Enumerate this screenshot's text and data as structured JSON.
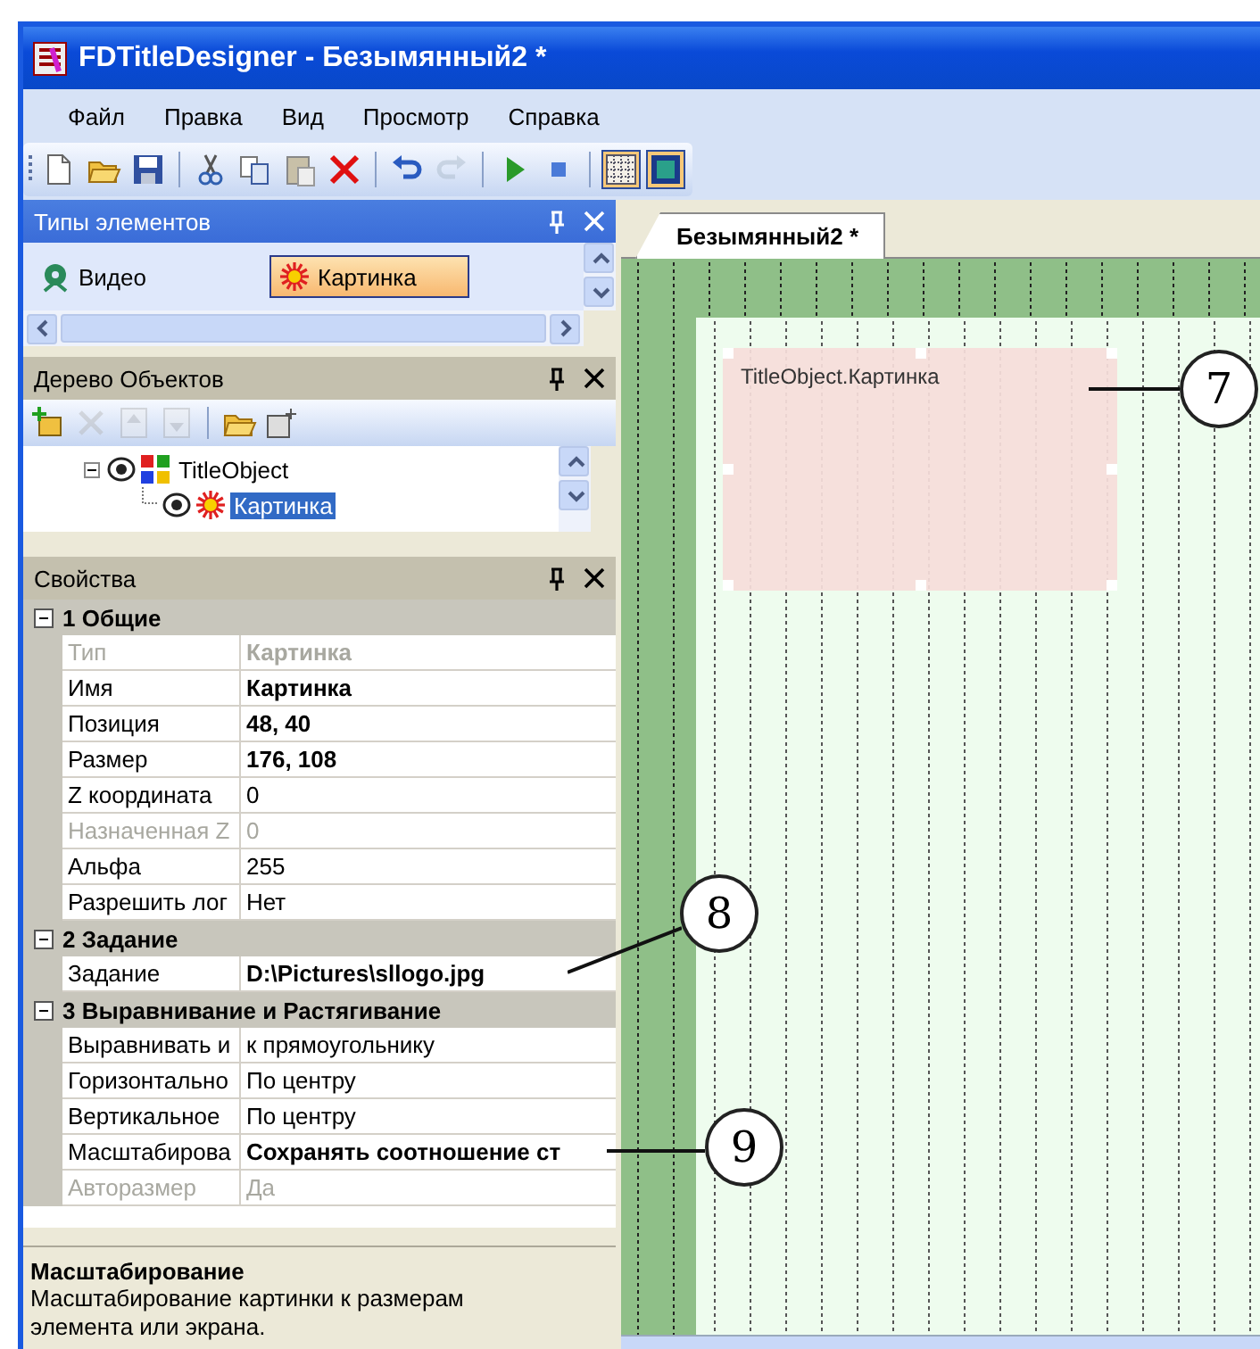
{
  "window": {
    "title": "FDTitleDesigner - Безымянный2 *"
  },
  "menu": [
    {
      "label": "Файл"
    },
    {
      "label": "Правка"
    },
    {
      "label": "Вид"
    },
    {
      "label": "Просмотр"
    },
    {
      "label": "Справка"
    }
  ],
  "toolbar": [
    {
      "kind": "new",
      "pressed": false,
      "disabled": false
    },
    {
      "kind": "open",
      "pressed": false,
      "disabled": false
    },
    {
      "kind": "save",
      "pressed": false,
      "disabled": false
    },
    {
      "kind": "separator"
    },
    {
      "kind": "cut",
      "pressed": false,
      "disabled": false
    },
    {
      "kind": "copy",
      "pressed": false,
      "disabled": false
    },
    {
      "kind": "paste",
      "pressed": false,
      "disabled": false
    },
    {
      "kind": "delete",
      "pressed": false,
      "disabled": false
    },
    {
      "kind": "separator"
    },
    {
      "kind": "undo",
      "pressed": false,
      "disabled": false
    },
    {
      "kind": "redo",
      "pressed": false,
      "disabled": true
    },
    {
      "kind": "separator"
    },
    {
      "kind": "play",
      "pressed": false,
      "disabled": false
    },
    {
      "kind": "stop",
      "pressed": false,
      "disabled": false
    },
    {
      "kind": "separator"
    },
    {
      "kind": "grid",
      "pressed": true,
      "disabled": false
    },
    {
      "kind": "frame",
      "pressed": true,
      "disabled": false
    }
  ],
  "element_types": {
    "title": "Типы элементов",
    "items": [
      {
        "label": "Видео",
        "kind": "video",
        "selected": false
      },
      {
        "label": "Картинка",
        "kind": "picture",
        "selected": true
      }
    ]
  },
  "object_tree": {
    "title": "Дерево Объектов",
    "tools": [
      {
        "kind": "add",
        "disabled": false
      },
      {
        "kind": "delete",
        "disabled": true
      },
      {
        "kind": "up",
        "disabled": true
      },
      {
        "kind": "down",
        "disabled": true
      },
      {
        "kind": "separator"
      },
      {
        "kind": "open",
        "disabled": false
      },
      {
        "kind": "export",
        "disabled": false
      }
    ],
    "nodes": [
      {
        "label": "TitleObject",
        "kind": "object",
        "expanded": true,
        "selected": false,
        "children": [
          {
            "label": "Картинка",
            "kind": "picture",
            "selected": true
          }
        ]
      }
    ]
  },
  "properties": {
    "title": "Свойства",
    "categories": [
      {
        "label": "1 Общие",
        "expanded": true,
        "rows": [
          {
            "name": "Тип",
            "value": "Картинка",
            "disabled": true,
            "modified": true
          },
          {
            "name": "Имя",
            "value": "Картинка",
            "disabled": false,
            "modified": true
          },
          {
            "name": "Позиция",
            "value": "48, 40",
            "disabled": false,
            "modified": true
          },
          {
            "name": "Размер",
            "value": "176, 108",
            "disabled": false,
            "modified": true
          },
          {
            "name": "Z координата",
            "value": "0",
            "disabled": false,
            "modified": false
          },
          {
            "name": "Назначенная Z",
            "value": "0",
            "disabled": true,
            "modified": false
          },
          {
            "name": "Альфа",
            "value": "255",
            "disabled": false,
            "modified": false
          },
          {
            "name": "Разрешить лог",
            "value": "Нет",
            "disabled": false,
            "modified": false
          }
        ]
      },
      {
        "label": "2 Задание",
        "expanded": true,
        "rows": [
          {
            "name": "Задание",
            "value": "D:\\Pictures\\sllogo.jpg",
            "disabled": false,
            "modified": true
          }
        ]
      },
      {
        "label": "3 Выравнивание и Растягивание",
        "expanded": true,
        "rows": [
          {
            "name": "Выравнивать и",
            "value": "к прямоугольнику",
            "disabled": false,
            "modified": false
          },
          {
            "name": "Горизонтально",
            "value": "По центру",
            "disabled": false,
            "modified": false
          },
          {
            "name": "Вертикальное",
            "value": "По центру",
            "disabled": false,
            "modified": false
          },
          {
            "name": "Масштабирова",
            "value": "Сохранять соотношение ст",
            "disabled": false,
            "modified": true
          },
          {
            "name": "Авторазмер",
            "value": "Да",
            "disabled": true,
            "modified": false
          }
        ]
      }
    ],
    "description": {
      "title": "Масштабирование",
      "text": "Масштабирование картинки к размерам элемента или экрана."
    }
  },
  "document_tabs": [
    {
      "label": "Безымянный2 *",
      "selected": true
    }
  ],
  "canvas": {
    "object_label": "TitleObject.Картинка"
  },
  "callouts": [
    {
      "number": "7"
    },
    {
      "number": "8"
    },
    {
      "number": "9"
    }
  ]
}
